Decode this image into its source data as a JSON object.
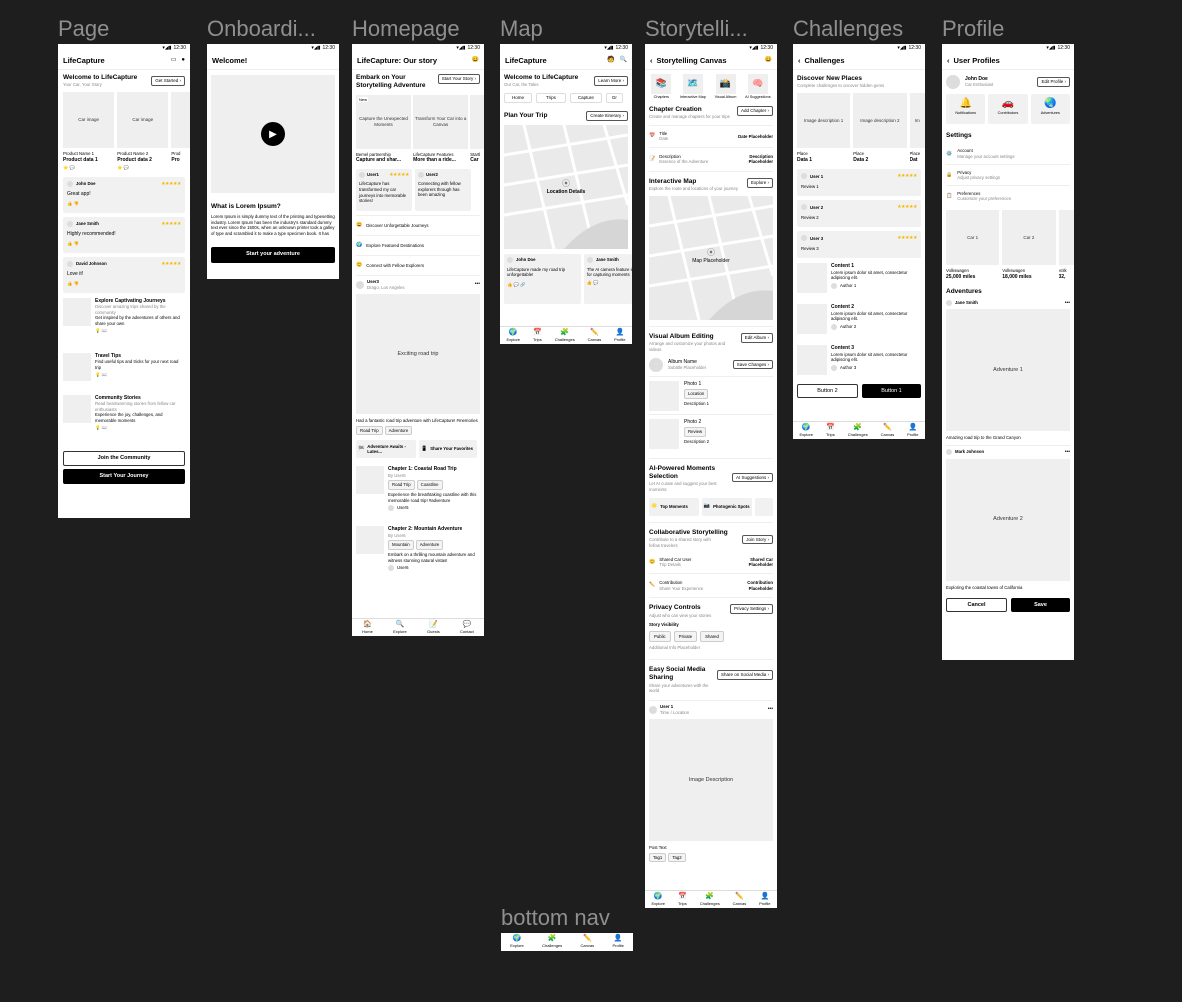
{
  "frames": {
    "page": "Page",
    "onboarding": "Onboardi...",
    "homepage": "Homepage",
    "map": "Map",
    "story": "Storytelli...",
    "challenges": "Challenges",
    "profile": "Profile",
    "bottomnav": "bottom nav"
  },
  "status_time": "12:30",
  "page": {
    "title": "LifeCapture",
    "welcome": "Welcome to LifeCapture",
    "tagline": "Your Car, Your Story",
    "get_started": "Get Started",
    "cards": [
      {
        "img": "Car image",
        "name": "Product Name 1",
        "data": "Product data 1"
      },
      {
        "img": "Car image",
        "name": "Product Name 2",
        "data": "Product data 2"
      },
      {
        "img": "",
        "name": "Prod",
        "data": "Pro"
      }
    ],
    "reviews": [
      {
        "name": "John Doe",
        "text": "Great app!"
      },
      {
        "name": "Jane Smith",
        "text": "Highly recommended!"
      },
      {
        "name": "David Johnson",
        "text": "Love it!"
      }
    ],
    "features": [
      {
        "title": "Explore Captivating Journeys",
        "sub": "Discover amazing trips shared by the community",
        "desc": "Get inspired by the adventures of others and share your own"
      },
      {
        "title": "Travel Tips",
        "sub": "",
        "desc": "Find useful tips and tricks for your next road trip"
      },
      {
        "title": "Community Stories",
        "sub": "Read heartwarming stories from fellow car enthusiasts",
        "desc": "Experience the joy, challenges, and memorable moments"
      }
    ],
    "join": "Join the Community",
    "start": "Start Your Journey"
  },
  "onboarding": {
    "title": "Welcome!",
    "heading": "What is Lorem Ipsum?",
    "body": "Lorem Ipsum is simply dummy text of the printing and typesetting industry. Lorem Ipsum has been the industry's standard dummy text ever since the 1500s, when an unknown printer took a galley of type and scrambled it to make a type specimen book. It has",
    "cta": "Start your adventure"
  },
  "homepage": {
    "title": "LifeCapture: Our story",
    "hero": "Embark on Your Storytelling Adventure",
    "start_story": "Start Your Story",
    "new_badge": "New",
    "slides": [
      {
        "img": "Capture the Unexpected Moments",
        "label": "Bemel partnership",
        "title": "Capture and shar..."
      },
      {
        "img": "Transform Your Car into a Canvas",
        "label": "LifeCapture Features",
        "title": "More than a ride..."
      },
      {
        "img": "",
        "label": "Startl",
        "title": "Car"
      }
    ],
    "testimonials": [
      {
        "user": "User1",
        "text": "LifeCapture has transformed my car journeys into memorable stories!"
      },
      {
        "user": "User2",
        "text": "Connecting with fellow explorers through has been amazing"
      }
    ],
    "links": [
      "Discover Unforgettable Journeys",
      "Explore Featured Destinations",
      "Connect with Fellow Explorers"
    ],
    "post_user": "User3",
    "post_loc": "Drago, Los Angeles",
    "post_img": "Exciting road trip",
    "post_caption": "Had a fantastic road trip adventure with LifeCapture! #memories",
    "post_tags": [
      "Road Trip",
      "Adventure"
    ],
    "actions": [
      "Adventure Awaits - Lates...",
      "Share Your Favorites"
    ],
    "chapters": [
      {
        "title": "Chapter 1: Coastal Road Trip",
        "by": "By User5",
        "tags": [
          "Road Trip",
          "Coastline"
        ],
        "desc": "Experience the breathtaking coastline with this memorable road trip! #adventure",
        "user": "User5"
      },
      {
        "title": "Chapter 2: Mountain Adventure",
        "by": "By User6",
        "tags": [
          "Mountain",
          "Adventure"
        ],
        "desc": "Embark on a thrilling mountain adventure and witness stunning natural vistas!",
        "user": "User6"
      }
    ],
    "nav": [
      "Home",
      "Explore",
      "Guests",
      "Contact"
    ]
  },
  "map": {
    "title": "LifeCapture",
    "welcome": "Welcome to LifeCapture",
    "tagline": "Our Car, the Tales",
    "learn": "Learn More",
    "tabs": [
      "Home",
      "Trips",
      "Capture",
      "Gr"
    ],
    "plan": "Plan Your Trip",
    "itinerary": "Create Itinerary",
    "location": "Location Details",
    "reviews": [
      {
        "name": "John Doe",
        "text": "LifeCapture made my road trip unforgettable!"
      },
      {
        "name": "Jane Smith",
        "text": "The AI camera feature is amazing for capturing moments"
      }
    ],
    "nav": [
      "Explore",
      "Trips",
      "Challenges",
      "Canvas",
      "Profile"
    ]
  },
  "story": {
    "title": "Storytelling Canvas",
    "cats": [
      "Chapters",
      "Interactive Map",
      "Visual Album",
      "AI Suggestions"
    ],
    "chapter_title": "Chapter Creation",
    "chapter_sub": "Create and manage chapters for your trips",
    "add_chapter": "Add Chapter",
    "items": [
      {
        "label": "Title",
        "sub": "Date",
        "right": "Date Placeholder"
      },
      {
        "label": "Description",
        "sub": "Essence of the Adventure",
        "right": "Description Placeholder"
      }
    ],
    "map_title": "Interactive Map",
    "map_sub": "Explore the route and locations of your journey",
    "explore": "Explore",
    "map_ph": "Map Placeholder",
    "album_title": "Visual Album Editing",
    "album_sub": "Arrange and customize your photos and videos",
    "edit_album": "Edit Album",
    "album_name": "Album Name",
    "album_sub2": "Subtitle Placeholder",
    "save_changes": "Save Changes",
    "photos": [
      {
        "title": "Photo 1",
        "chip": "Location",
        "desc": "Description 1"
      },
      {
        "title": "Photo 2",
        "chip": "Review",
        "desc": "Description 2"
      }
    ],
    "ai_title": "AI-Powered Moments Selection",
    "ai_sub": "Let AI curate and suggest your best moments",
    "ai_btn": "AI Suggestions",
    "ai_chips": [
      "Top Moments",
      "Photogenic Spots"
    ],
    "collab_title": "Collaborative Storytelling",
    "collab_sub": "Contribute to a shared story with fellow travelers",
    "join_story": "Join Story",
    "collab_items": [
      {
        "label": "Shared Car User",
        "sub": "Trip Details",
        "right": "Shared Car Placeholder"
      },
      {
        "label": "Contribution",
        "sub": "Share Your Experience",
        "right": "Contribution Placeholder"
      }
    ],
    "privacy_title": "Privacy Controls",
    "privacy_sub": "Adjust who can view your stories",
    "privacy_btn": "Privacy Settings",
    "visibility": "Story Visibility",
    "vis_opts": [
      "Public",
      "Private",
      "Shared"
    ],
    "addl": "Additional Info Placeholder",
    "share_title": "Easy Social Media Sharing",
    "share_sub": "Share your adventures with the world",
    "share_btn": "Share on Social Media",
    "post_user": "User 1",
    "post_loc": "Time / Location",
    "post_img": "Image Description",
    "post_text": "Post Text",
    "tags": [
      "Tag1",
      "Tag2"
    ]
  },
  "challenges": {
    "title": "Challenges",
    "discover": "Discover New Places",
    "discover_sub": "Complete challenges to uncover hidden gems",
    "places": [
      {
        "img": "Image description 1",
        "label": "Place",
        "data": "Data 1"
      },
      {
        "img": "Image description 2",
        "label": "Place",
        "data": "Data 2"
      },
      {
        "img": "Im",
        "label": "Place",
        "data": "Dat"
      }
    ],
    "reviews": [
      {
        "user": "User 1",
        "text": "Review 1"
      },
      {
        "user": "User 2",
        "text": "Review 2"
      },
      {
        "user": "User 3",
        "text": "Review 3"
      }
    ],
    "contents": [
      {
        "title": "Content 1",
        "body": "Lorem ipsum dolor sit amet, consectetur adipiscing elit.",
        "author": "Author 1"
      },
      {
        "title": "Content 2",
        "body": "Lorem ipsum dolor sit amet, consectetur adipiscing elit.",
        "author": "Author 2"
      },
      {
        "title": "Content 3",
        "body": "Lorem ipsum dolor sit amet, consectetur adipiscing elit.",
        "author": "Author 3"
      }
    ],
    "btn2": "Button 2",
    "btn1": "Button 1"
  },
  "profile": {
    "title": "User Profiles",
    "name": "John Doe",
    "sub": "Car Enthusiast",
    "edit": "Edit Profile",
    "badges": [
      "Notifications",
      "Contributors",
      "Adventures"
    ],
    "settings_title": "Settings",
    "settings": [
      {
        "label": "Account",
        "sub": "Manage your account settings"
      },
      {
        "label": "Privacy",
        "sub": "Adjust privacy settings"
      },
      {
        "label": "Preferences",
        "sub": "Customize your preferences"
      }
    ],
    "cars": [
      {
        "img": "Car 1",
        "brand": "Volkswagen",
        "miles": "25,000 miles"
      },
      {
        "img": "Car 2",
        "brand": "Volkswagen",
        "miles": "18,000 miles"
      },
      {
        "img": "",
        "brand": "Volk",
        "miles": "32,"
      }
    ],
    "adv_title": "Adventures",
    "posts": [
      {
        "user": "Jane Smith",
        "img": "Adventure 1",
        "caption": "Amazing road trip to the Grand Canyon"
      },
      {
        "user": "Mark Johnson",
        "img": "Adventure 2",
        "caption": "Exploring the coastal towns of California"
      }
    ],
    "cancel": "Cancel",
    "save": "Save"
  },
  "bottomnav": {
    "items": [
      "Explore",
      "Challenges",
      "Canvas",
      "Profile"
    ]
  }
}
